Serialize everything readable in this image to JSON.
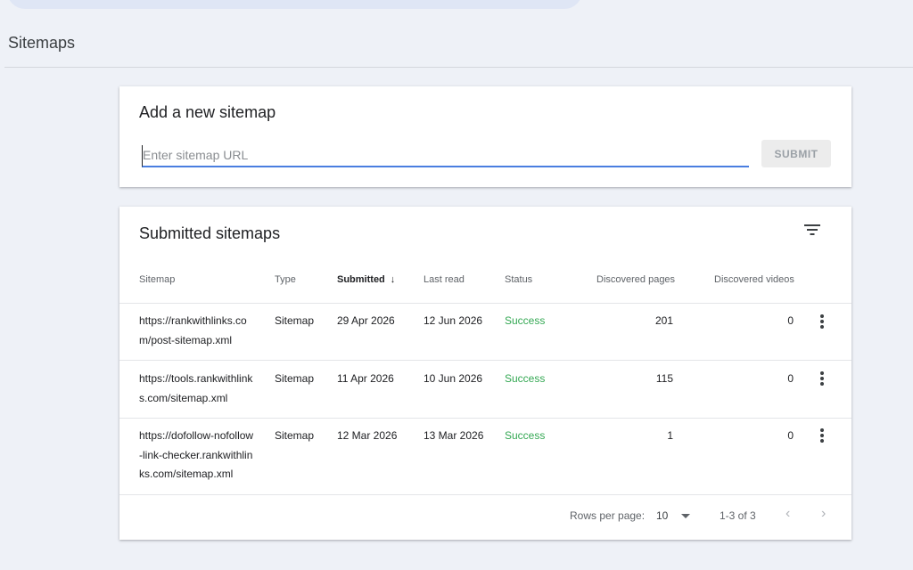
{
  "page": {
    "title": "Sitemaps"
  },
  "add_sitemap": {
    "title": "Add a new sitemap",
    "input_placeholder": "Enter sitemap URL",
    "input_value": "",
    "submit_label": "SUBMIT"
  },
  "submitted": {
    "title": "Submitted sitemaps",
    "columns": [
      "Sitemap",
      "Type",
      "Submitted",
      "Last read",
      "Status",
      "Discovered pages",
      "Discovered videos"
    ],
    "sort_indicator": "↓",
    "rows": [
      {
        "sitemap": "https://rankwithlinks.com/post-sitemap.xml",
        "type": "Sitemap",
        "submitted": "29 Apr 2026",
        "last_read": "12 Jun 2026",
        "status": "Success",
        "pages": "201",
        "videos": "0"
      },
      {
        "sitemap": "https://tools.rankwithlinks.com/sitemap.xml",
        "type": "Sitemap",
        "submitted": "11 Apr 2026",
        "last_read": "10 Jun 2026",
        "status": "Success",
        "pages": "115",
        "videos": "0"
      },
      {
        "sitemap": "https://dofollow-nofollow-link-checker.rankwithlinks.com/sitemap.xml",
        "type": "Sitemap",
        "submitted": "12 Mar 2026",
        "last_read": "13 Mar 2026",
        "status": "Success",
        "pages": "1",
        "videos": "0"
      }
    ],
    "footer": {
      "rows_per_page_label": "Rows per page:",
      "rows_per_page_value": "10",
      "range_label": "1-3 of 3",
      "prev_glyph": "‹",
      "next_glyph": "›"
    }
  },
  "icons": {
    "filter": "filter-icon",
    "more": "more-vert-icon",
    "sort": "arrow-down-icon",
    "caret": "dropdown-caret-icon"
  },
  "colors": {
    "background": "#eef1f7",
    "accent": "#4a7ee0",
    "success": "#34a853"
  }
}
